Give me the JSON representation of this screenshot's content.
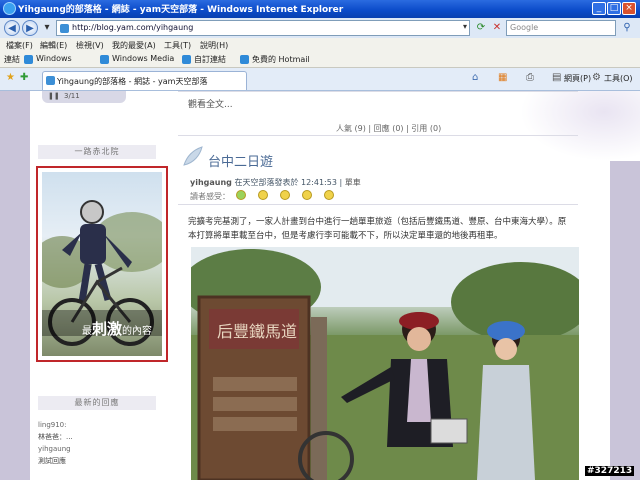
{
  "window": {
    "title": "Yihgaung的部落格 - 網誌 - yam天空部落 - Windows Internet Explorer",
    "minimize": "_",
    "maximize": "□",
    "close": "×"
  },
  "address_bar": {
    "url": "http://blog.yam.com/yihgaung",
    "search_placeholder": "Google"
  },
  "menu": [
    "檔案(F)",
    "編輯(E)",
    "檢視(V)",
    "我的最愛(A)",
    "工具(T)",
    "說明(H)"
  ],
  "links_bar": {
    "label": "連結",
    "items": [
      "Windows",
      "Windows Media",
      "自訂連結",
      "免費的 Hotmail"
    ]
  },
  "tab": {
    "title": "Yihgaung的部落格 - 網誌 - yam天空部落",
    "right_items": [
      "網頁(P)",
      "工具(O)"
    ]
  },
  "player": {
    "counter": "3/11"
  },
  "sidebar": {
    "section1_title": "一路赤北院",
    "ad_caption_small": "最",
    "ad_caption_big": "刺激",
    "ad_caption_tail": "的內容",
    "section2_title": "最新的回應",
    "comments": [
      "ling910:",
      "林爸爸：...",
      "yihgaung",
      "測試回應"
    ]
  },
  "main": {
    "read_more": "觀看全文...",
    "stats": "人氣 (9) | 回應 (0) | 引用 (0)",
    "post_title": "台中二日遊",
    "meta_author": "yihgaung",
    "meta_text": " 在天空部落發表於 12:41:53 | ",
    "meta_category": "單車",
    "mood_label": "讀者感受：",
    "body_line1": "完擴考完基測了，一家人計畫到台中進行一趟單車旅遊（包括后豐鐵馬道、豐原、台中東海大學）。原",
    "body_line2": "本打算將單車載至台中，但是考慮行李可能載不下，所以決定單車還的地後再租車。",
    "sign_text": "后豐鐵馬道"
  },
  "watermark_code": "#327213"
}
